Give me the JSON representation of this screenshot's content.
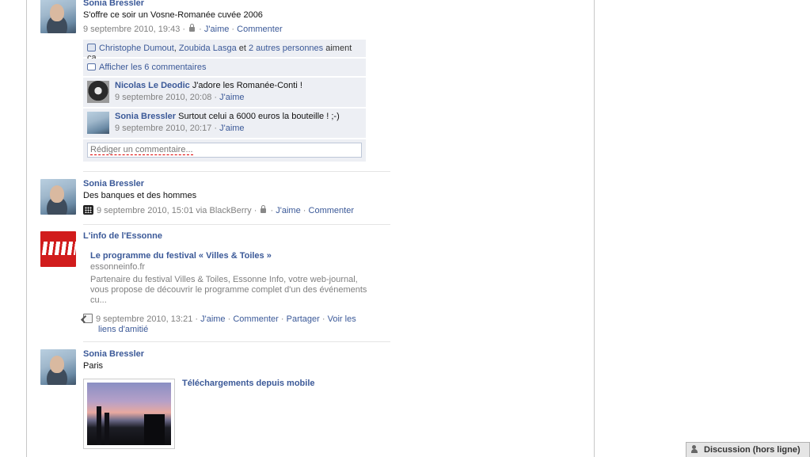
{
  "feed": {
    "story1": {
      "author": "Sonia Bressler",
      "message": "S'offre ce soir un Vosne-Romanée cuvée 2006",
      "date": "9 septembre 2010, 19:43",
      "like": "J'aime",
      "comment": "Commenter",
      "likes": {
        "person1": "Christophe Dumout",
        "person2": "Zoubida Lasga",
        "and": "et",
        "others": "2 autres personnes",
        "suffix": "aiment ça."
      },
      "show_comments": "Afficher les 6 commentaires",
      "comments": [
        {
          "author": "Nicolas Le Deodic",
          "text": "J'adore les Romanée-Conti !",
          "date": "9 septembre 2010, 20:08",
          "like": "J'aime"
        },
        {
          "author": "Sonia Bressler",
          "text": "Surtout celui a 6000 euros la bouteille ! ;-)",
          "date": "9 septembre 2010, 20:17",
          "like": "J'aime"
        }
      ],
      "comment_placeholder": "Rédiger un commentaire..."
    },
    "story2": {
      "author": "Sonia Bressler",
      "message": "Des banques et des hommes",
      "date": "9 septembre 2010, 15:01 via BlackBerry",
      "like": "J'aime",
      "comment": "Commenter"
    },
    "story3": {
      "author": "L'info de l'Essonne",
      "attachment_title": "Le programme du festival « Villes & Toiles »",
      "attachment_domain": "essonneinfo.fr",
      "attachment_desc": "Partenaire du festival Villes & Toiles, Essonne Info, votre web-journal, vous propose de découvrir le programme complet d'un des événements cu...",
      "date": "9 septembre 2010, 13:21",
      "like": "J'aime",
      "comment": "Commenter",
      "share": "Partager",
      "see_friendship_1": "Voir les",
      "see_friendship_2": "liens d'amitié"
    },
    "story4": {
      "author": "Sonia Bressler",
      "message": "Paris",
      "album_link": "Téléchargements depuis mobile"
    }
  },
  "chat": {
    "label": "Discussion (hors ligne)"
  },
  "separator": "·"
}
